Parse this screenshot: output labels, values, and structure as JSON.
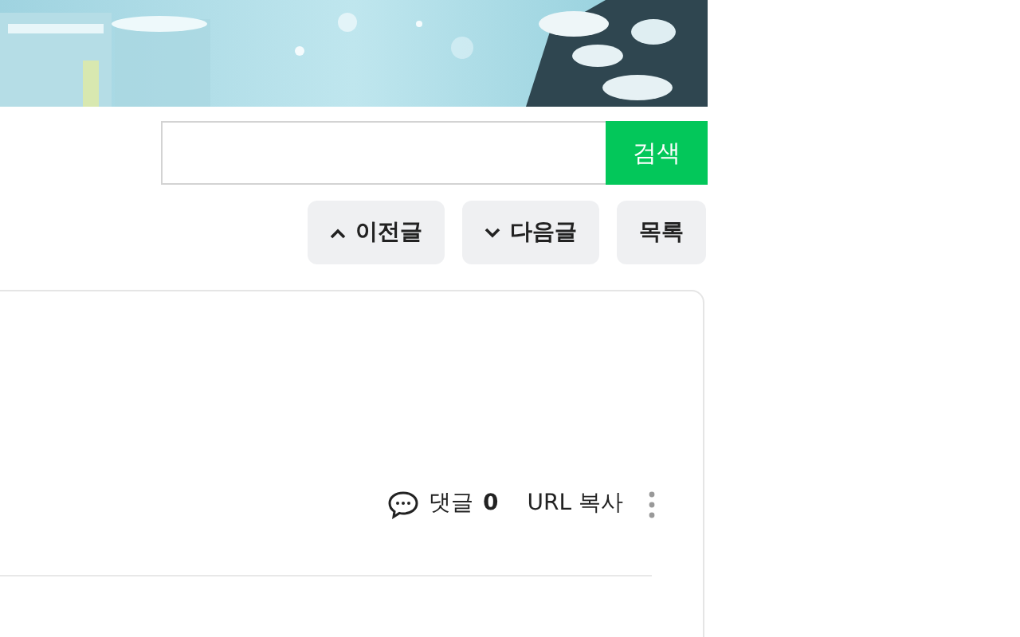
{
  "search": {
    "button": "검색"
  },
  "nav_buttons": [
    {
      "kind": "prev",
      "label": "이전글"
    },
    {
      "kind": "next",
      "label": "다음글"
    },
    {
      "kind": "list",
      "label": "목록"
    }
  ],
  "post": {
    "comment_label": "댓글",
    "comment_count": "0",
    "copy_url": "URL 복사"
  }
}
